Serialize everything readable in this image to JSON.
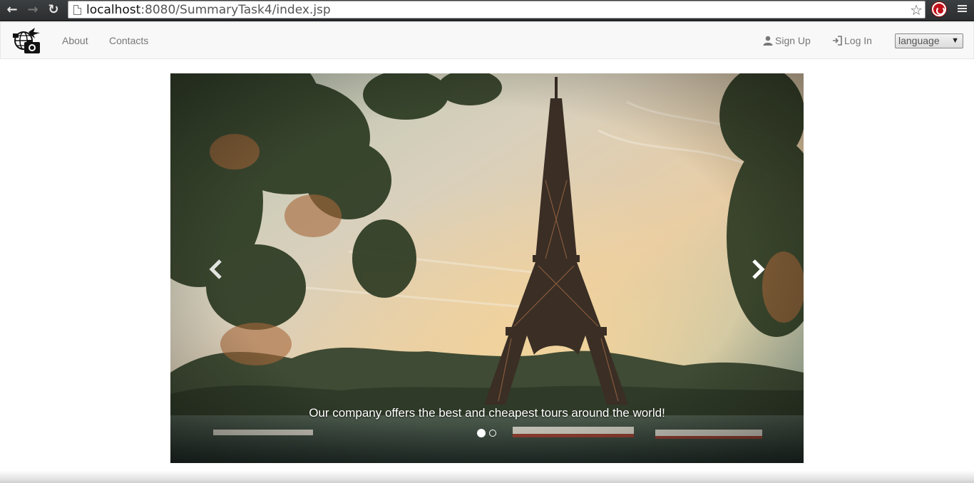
{
  "browser": {
    "url_host": "localhost",
    "url_rest": ":8080/SummaryTask4/index.jsp",
    "back_icon": "arrow-left-icon",
    "forward_icon": "arrow-right-icon",
    "reload_icon": "reload-icon",
    "bookmark_icon": "star-icon",
    "extension_icon": "adblock-icon",
    "menu_icon": "hamburger-menu-icon"
  },
  "navbar": {
    "brand_icon": "globe-camera-logo",
    "links": [
      {
        "label": "About"
      },
      {
        "label": "Contacts"
      }
    ],
    "sign_up_label": "Sign Up",
    "log_in_label": "Log In",
    "language_selected": "language"
  },
  "carousel": {
    "caption": "Our company offers the best and cheapest tours around the world!",
    "slide_count": 2,
    "active_slide": 1,
    "prev_icon": "chevron-left-icon",
    "next_icon": "chevron-right-icon"
  },
  "colors": {
    "navbar_bg": "#f8f8f8",
    "link": "#777777",
    "chrome": "#2b2d2f"
  }
}
